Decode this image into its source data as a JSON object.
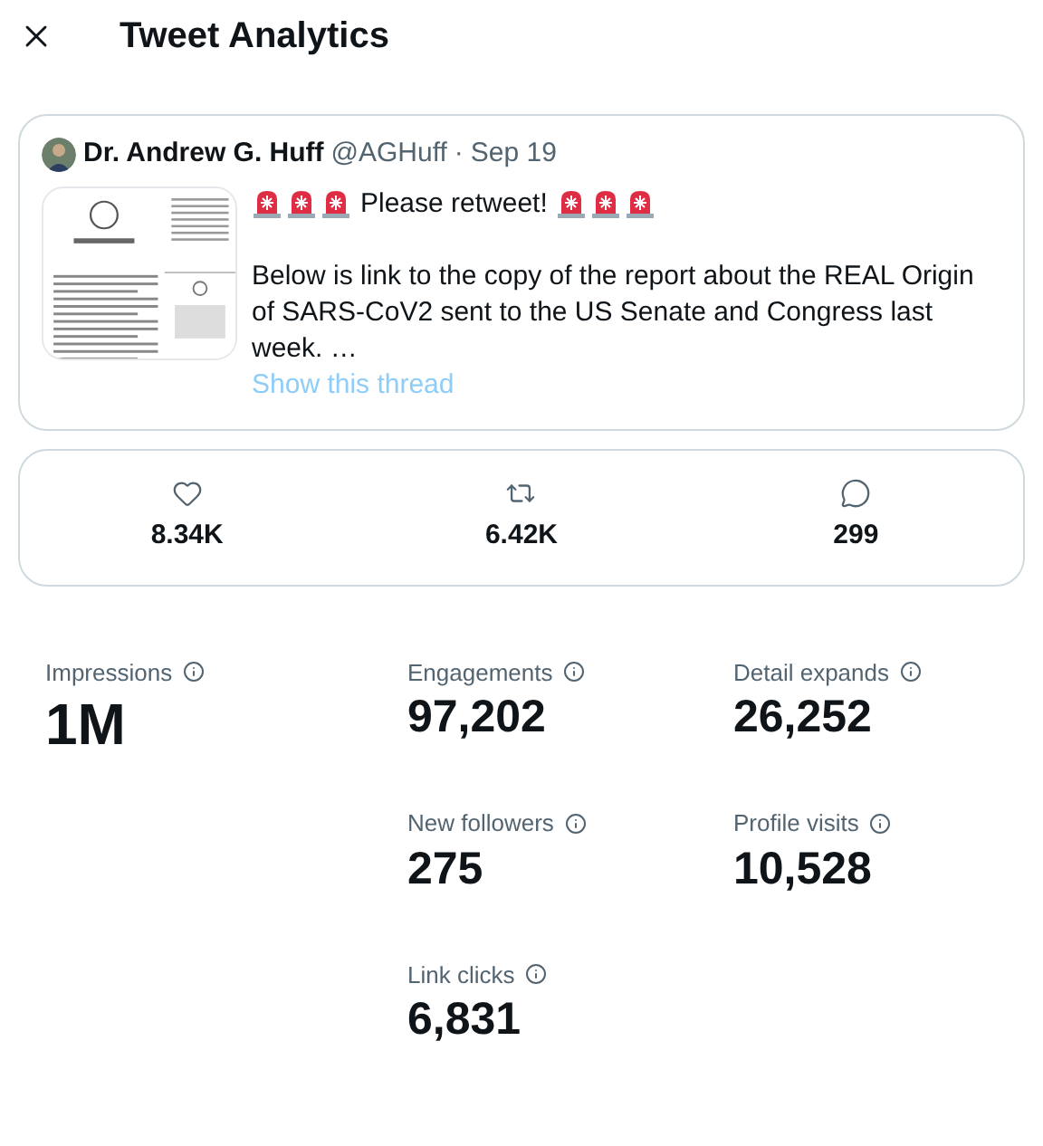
{
  "header": {
    "title": "Tweet Analytics"
  },
  "tweet": {
    "author": "Dr. Andrew G. Huff",
    "handle": "@AGHuff",
    "separator": "·",
    "date": "Sep 19",
    "headline": "Please retweet!",
    "body": "Below is link to the copy of the report about the REAL Origin of SARS-CoV2 sent to the US Senate and Congress last week. …",
    "thread_link": "Show this thread"
  },
  "engagement_counts": [
    {
      "kind": "like",
      "value": "8.34K"
    },
    {
      "kind": "retweet",
      "value": "6.42K"
    },
    {
      "kind": "reply",
      "value": "299"
    }
  ],
  "metrics": [
    {
      "label": "Impressions",
      "value": "1M",
      "kind": "primary"
    },
    {
      "label": "Engagements",
      "value": "97,202",
      "kind": "secondary"
    },
    {
      "label": "Detail expands",
      "value": "26,252",
      "kind": "secondary"
    },
    {
      "label": "New followers",
      "value": "275",
      "kind": "secondary"
    },
    {
      "label": "Profile visits",
      "value": "10,528",
      "kind": "secondary"
    },
    {
      "label": "Link clicks",
      "value": "6,831",
      "kind": "secondary"
    }
  ]
}
